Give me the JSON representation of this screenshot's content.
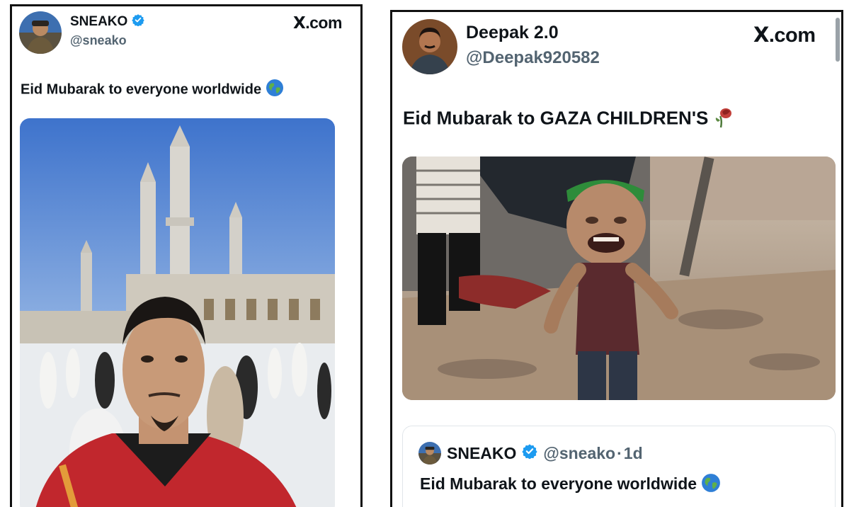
{
  "left_tweet": {
    "author_name": "SNEAKO",
    "author_handle": "@sneako",
    "site": "X.com",
    "site_x": "X",
    "site_rest": ".com",
    "text": "Eid Mubarak to everyone worldwide",
    "emoji": "globe-icon",
    "media": "photo of man taking selfie in front of mosque minarets"
  },
  "right_tweet": {
    "author_name": "Deepak 2.0",
    "author_handle": "@Deepak920582",
    "site": "X.com",
    "site_x": "X",
    "site_rest": ".com",
    "text": "Eid Mubarak to GAZA CHILDREN'S",
    "emoji": "wilted-rose-icon",
    "media": "image of crying child in rubble",
    "quoted": {
      "author_name": "SNEAKO",
      "author_handle": "@sneako",
      "separator": "·",
      "time": "1d",
      "text": "Eid Mubarak to everyone worldwide"
    }
  },
  "colors": {
    "verified": "#1d9bf0",
    "handle": "#536471",
    "text": "#0f1419",
    "sky": "#4d7fd1"
  }
}
